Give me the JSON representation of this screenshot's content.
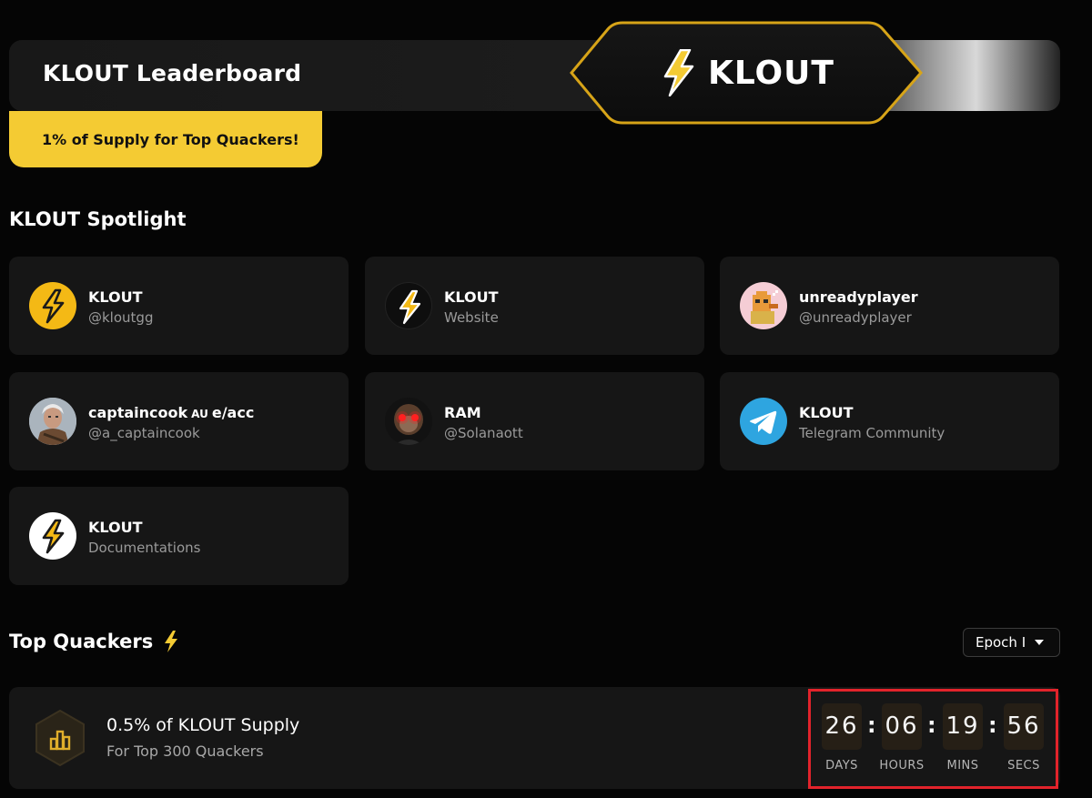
{
  "header": {
    "title": "KLOUT Leaderboard",
    "promo": "1% of Supply for Top Quackers!",
    "badge_text": "KLOUT"
  },
  "spotlight": {
    "title": "KLOUT Spotlight",
    "cards": [
      {
        "name": "KLOUT",
        "sub": "@kloutgg",
        "icon": "klout-bolt-yellow"
      },
      {
        "name": "KLOUT",
        "sub": "Website",
        "icon": "klout-bolt-dark"
      },
      {
        "name": "unreadyplayer",
        "sub": "@unreadyplayer",
        "icon": "pixel-duck-avatar"
      },
      {
        "name": "captaincook",
        "name_tag": "AU",
        "name_suffix": "e/acc",
        "sub": "@a_captaincook",
        "icon": "warrior-avatar"
      },
      {
        "name": "RAM",
        "sub": "@Solanaott",
        "icon": "monkey-red-eyes-avatar"
      },
      {
        "name": "KLOUT",
        "sub": "Telegram Community",
        "icon": "telegram-icon"
      },
      {
        "name": "KLOUT",
        "sub": "Documentations",
        "icon": "klout-bolt-white"
      }
    ]
  },
  "quackers": {
    "title": "Top Quackers",
    "epoch": "Epoch I",
    "supply_title": "0.5% of KLOUT Supply",
    "supply_sub": "For Top 300 Quackers"
  },
  "countdown": {
    "days": "26",
    "hours": "06",
    "mins": "19",
    "secs": "56",
    "labels": {
      "days": "DAYS",
      "hours": "HOURS",
      "mins": "MINS",
      "secs": "SECS"
    },
    "separator": ":"
  },
  "colors": {
    "accent": "#f4cb33",
    "card_bg": "#161616",
    "highlight": "#e2232b",
    "telegram": "#2ea5e0"
  }
}
